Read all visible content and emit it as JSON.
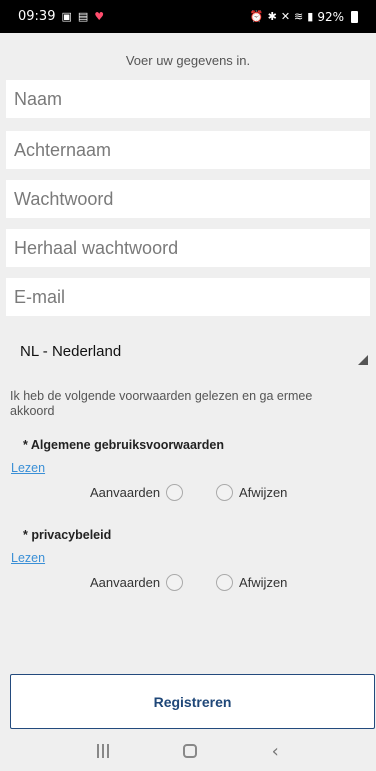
{
  "status_bar": {
    "time": "09:39",
    "left_icons": [
      "gallery-icon",
      "contact-card-icon",
      "heart-icon"
    ],
    "right_icons": [
      "alarm-icon",
      "bluetooth-icon",
      "mute-icon",
      "wifi-icon",
      "signal-icon"
    ],
    "battery": "92%"
  },
  "intro_text": "Voer uw gegevens in.",
  "fields": {
    "first_name": "Naam",
    "last_name": "Achternaam",
    "password": "Wachtwoord",
    "repeat_password": "Herhaal wachtwoord",
    "email": "E-mail"
  },
  "country_select": {
    "selected": "NL - Nederland"
  },
  "terms_intro": "Ik heb de volgende voorwaarden gelezen en ga ermee akkoord",
  "terms": [
    {
      "title": "* Algemene gebruiksvoorwaarden",
      "read_link": "Lezen",
      "accept": "Aanvaarden",
      "reject": "Afwijzen"
    },
    {
      "title": "* privacybeleid",
      "read_link": "Lezen",
      "accept": "Aanvaarden",
      "reject": "Afwijzen"
    }
  ],
  "register_button": "Registreren",
  "colors": {
    "accent_link": "#3a8fd6",
    "button_text": "#1f4778",
    "button_border": "#234a7d",
    "background": "#efefef"
  }
}
